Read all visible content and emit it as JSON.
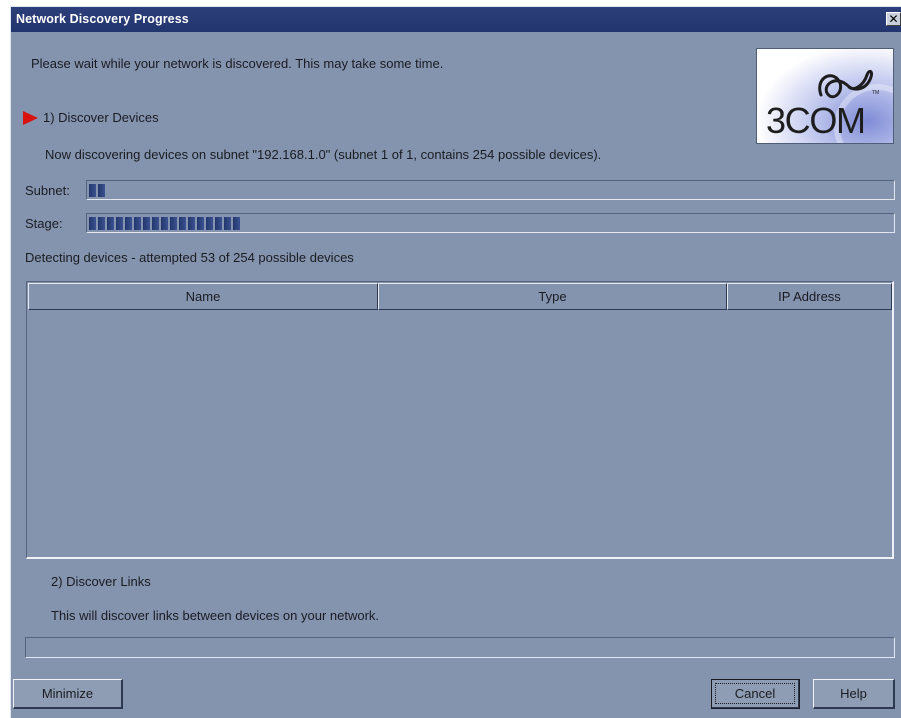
{
  "window": {
    "title": "Network Discovery Progress",
    "close_glyph": "✕"
  },
  "intro_text": "Please wait while your network is discovered.  This may take some time.",
  "logo": {
    "text": "3COM",
    "icon": "3com-logo-icon",
    "tm": "TM"
  },
  "step1": {
    "label": "1) Discover Devices",
    "status": "Now discovering devices on subnet \"192.168.1.0\" (subnet 1 of 1, contains 254 possible devices).",
    "active_indicator_icon": "right-arrow-icon",
    "accent_color": "#d9120e"
  },
  "progress": {
    "subnet_label": "Subnet:",
    "subnet_fraction": 0.025,
    "stage_label": "Stage:",
    "stage_fraction": 0.194
  },
  "detect_text": "Detecting devices - attempted 53 of 254 possible devices",
  "table": {
    "columns": [
      "Name",
      "Type",
      "IP Address"
    ],
    "rows": []
  },
  "step2": {
    "label": "2) Discover Links",
    "description": "This will discover links between devices on your network."
  },
  "links_progress_fraction": 0,
  "buttons": {
    "minimize": "Minimize",
    "cancel": "Cancel",
    "help": "Help"
  }
}
